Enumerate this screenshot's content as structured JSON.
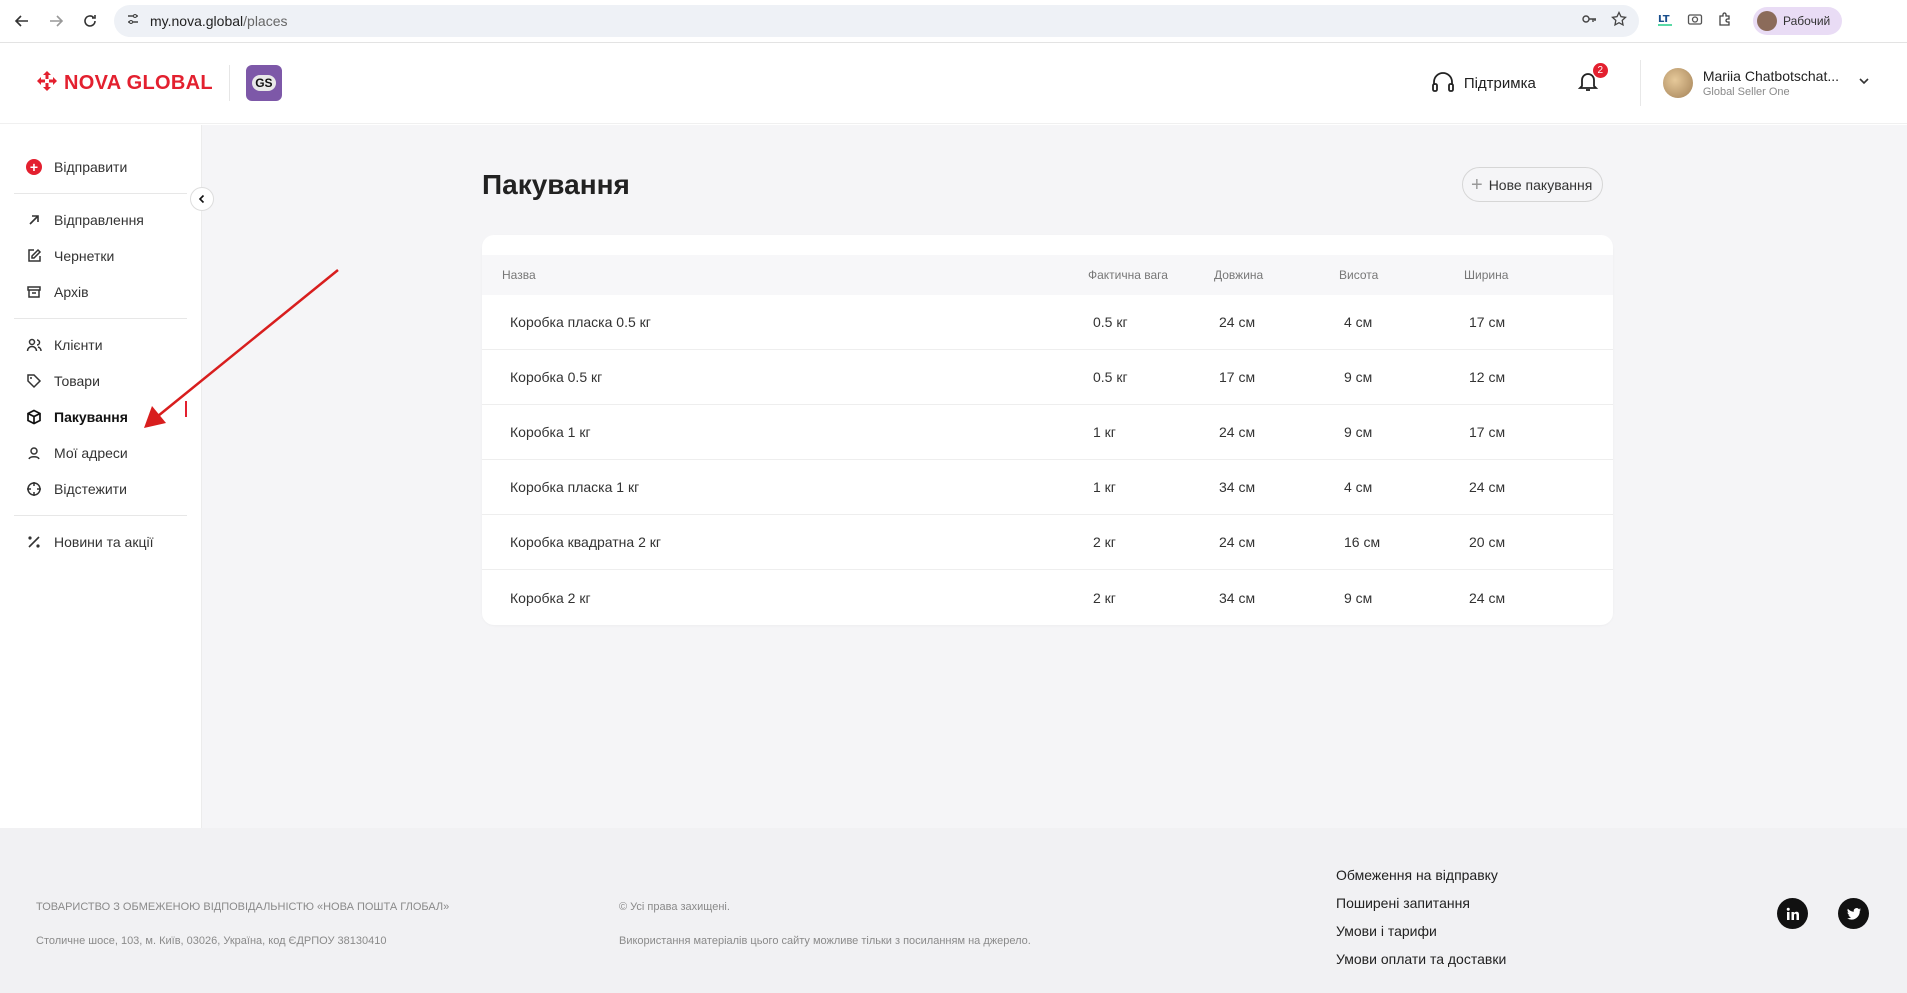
{
  "browser": {
    "url_host": "my.nova.global",
    "url_path": "/places",
    "profile_label": "Рабочий"
  },
  "header": {
    "brand": "NOVA GLOBAL",
    "gs_logo": "GS",
    "support_label": "Підтримка",
    "notification_count": "2",
    "user_name": "Mariia Chatbotschat...",
    "user_role": "Global Seller One"
  },
  "sidebar": {
    "send_label": "Відправити",
    "group1": [
      {
        "label": "Відправлення",
        "icon": "arrow-up-right-icon"
      },
      {
        "label": "Чернетки",
        "icon": "edit-icon"
      },
      {
        "label": "Архів",
        "icon": "archive-icon"
      }
    ],
    "group2": [
      {
        "label": "Клієнти",
        "icon": "users-icon"
      },
      {
        "label": "Товари",
        "icon": "tag-icon"
      },
      {
        "label": "Пакування",
        "icon": "box-icon",
        "active": true
      },
      {
        "label": "Мої адреси",
        "icon": "address-icon"
      },
      {
        "label": "Відстежити",
        "icon": "target-icon"
      }
    ],
    "group3": [
      {
        "label": "Новини та акції",
        "icon": "percent-icon"
      }
    ]
  },
  "main": {
    "title": "Пакування",
    "new_button": "Нове пакування",
    "table": {
      "headers": [
        "Назва",
        "Фактична вага",
        "Довжина",
        "Висота",
        "Ширина"
      ],
      "rows": [
        [
          "Коробка пласка 0.5 кг",
          "0.5 кг",
          "24 см",
          "4 см",
          "17 см"
        ],
        [
          "Коробка 0.5 кг",
          "0.5 кг",
          "17 см",
          "9 см",
          "12 см"
        ],
        [
          "Коробка 1 кг",
          "1 кг",
          "24 см",
          "9 см",
          "17 см"
        ],
        [
          "Коробка пласка 1 кг",
          "1 кг",
          "34 см",
          "4 см",
          "24 см"
        ],
        [
          "Коробка квадратна 2 кг",
          "2 кг",
          "24 см",
          "16 см",
          "20 см"
        ],
        [
          "Коробка 2 кг",
          "2 кг",
          "34 см",
          "9 см",
          "24 см"
        ]
      ]
    }
  },
  "footer": {
    "company": "ТОВАРИСТВО З ОБМЕЖЕНОЮ ВІДПОВІДАЛЬНІСТЮ «НОВА ПОШТА ГЛОБАЛ»",
    "address": "Столичне шосе, 103, м. Київ, 03026, Україна, код ЄДРПОУ 38130410",
    "rights": "© Усі права захищені.",
    "usage": "Використання матеріалів цього сайту можливе тільки з посиланням на джерело.",
    "links": [
      "Обмеження на відправку",
      "Поширені запитання",
      "Умови і тарифи",
      "Умови оплати та доставки"
    ]
  },
  "colors": {
    "brand_red": "#e3202f",
    "gs_purple": "#7d58a8",
    "annotation_arrow": "#d81e1e"
  }
}
